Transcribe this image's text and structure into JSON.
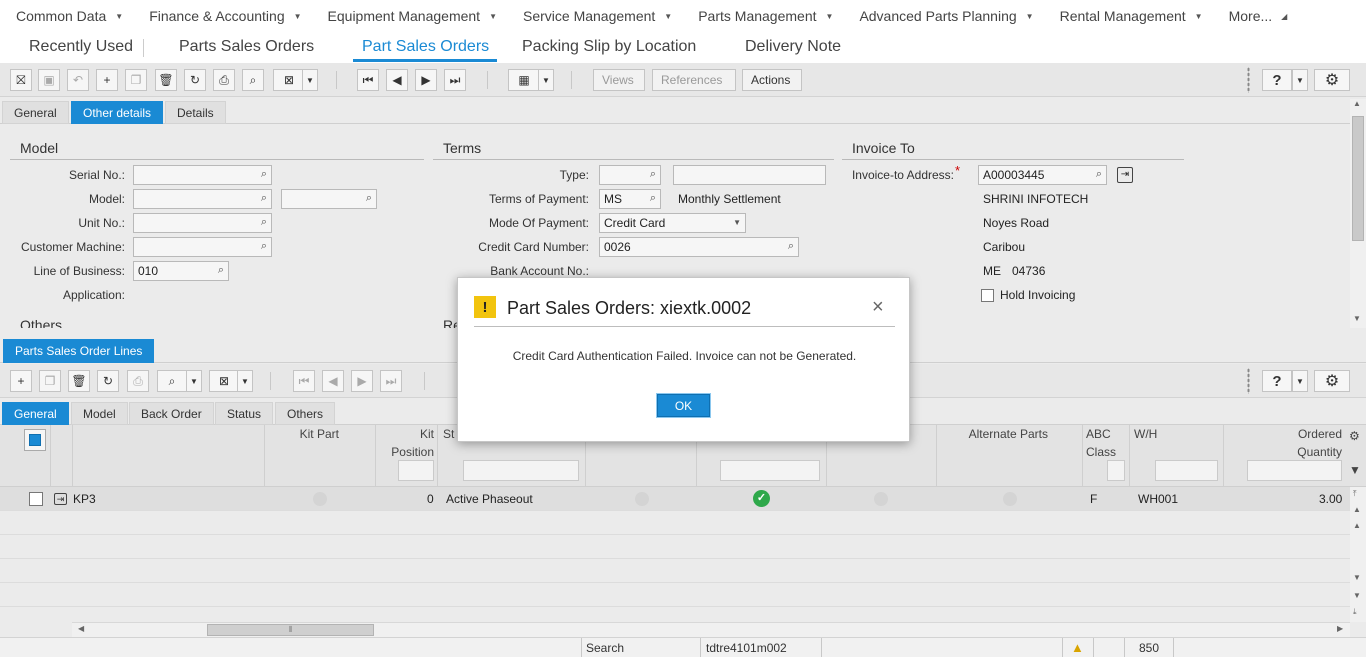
{
  "top_menu": [
    {
      "label": "Common Data"
    },
    {
      "label": "Finance & Accounting"
    },
    {
      "label": "Equipment Management"
    },
    {
      "label": "Service Management"
    },
    {
      "label": "Parts Management"
    },
    {
      "label": "Advanced Parts Planning"
    },
    {
      "label": "Rental Management"
    },
    {
      "label": "More..."
    }
  ],
  "tabs": {
    "recently_used": "Recently Used",
    "parts_sales_orders": "Parts Sales Orders",
    "part_sales_orders": "Part Sales Orders",
    "packing_slip": "Packing Slip by Location",
    "delivery_note": "Delivery Note"
  },
  "toolbar": {
    "views": "Views",
    "references": "References",
    "actions": "Actions"
  },
  "header_subtabs": {
    "general": "General",
    "other_details": "Other details",
    "details": "Details"
  },
  "model_section": {
    "title": "Model",
    "serial_no_label": "Serial No.:",
    "model_label": "Model:",
    "unit_no_label": "Unit No.:",
    "customer_machine_label": "Customer Machine:",
    "line_of_business_label": "Line of Business:",
    "line_of_business_value": "010",
    "application_label": "Application:",
    "others_title": "Others"
  },
  "terms_section": {
    "title": "Terms",
    "type_label": "Type:",
    "terms_of_payment_label": "Terms of Payment:",
    "terms_of_payment_code": "MS",
    "terms_of_payment_desc": "Monthly Settlement",
    "mode_of_payment_label": "Mode Of Payment:",
    "mode_of_payment_value": "Credit Card",
    "credit_card_number_label": "Credit Card Number:",
    "credit_card_number_value": "0026",
    "bank_account_label": "Bank Account No.:",
    "re_label": "Re"
  },
  "invoice_section": {
    "title": "Invoice To",
    "address_label": "Invoice-to Address:",
    "required_mark": "*",
    "address_code": "A00003445",
    "name": "SHRINI INFOTECH",
    "street": "Noyes Road",
    "city": "Caribou",
    "state": "ME",
    "zip": "04736",
    "hold_invoicing_label": "Hold Invoicing"
  },
  "lines_panel": {
    "title": "Parts Sales Order Lines",
    "subtabs": {
      "general": "General",
      "model": "Model",
      "back_order": "Back Order",
      "status": "Status",
      "others": "Others"
    },
    "columns": {
      "kit_part": "Kit Part",
      "kit": "Kit",
      "position": "Position",
      "status_short": "St",
      "alternate_parts": "Alternate Parts",
      "abc": "ABC",
      "class": "Class",
      "wh": "W/H",
      "ordered": "Ordered",
      "quantity": "Quantity"
    },
    "rows": [
      {
        "item": "KP3",
        "kit_position": "0",
        "status": "Active Phaseout",
        "abc_class": "F",
        "warehouse": "WH001",
        "ordered_quantity": "3.00"
      }
    ]
  },
  "status_bar": {
    "mode": "Search",
    "session": "tdtre4101m002",
    "count": "850"
  },
  "dialog": {
    "title": "Part Sales Orders: xiextk.0002",
    "message": "Credit Card Authentication Failed. Invoice can not be Generated.",
    "ok_label": "OK",
    "close_glyph": "×",
    "warning_glyph": "!"
  },
  "colors": {
    "accent": "#1a8ad4",
    "warning": "#f2c40e",
    "ok_green": "#2ea84a"
  }
}
